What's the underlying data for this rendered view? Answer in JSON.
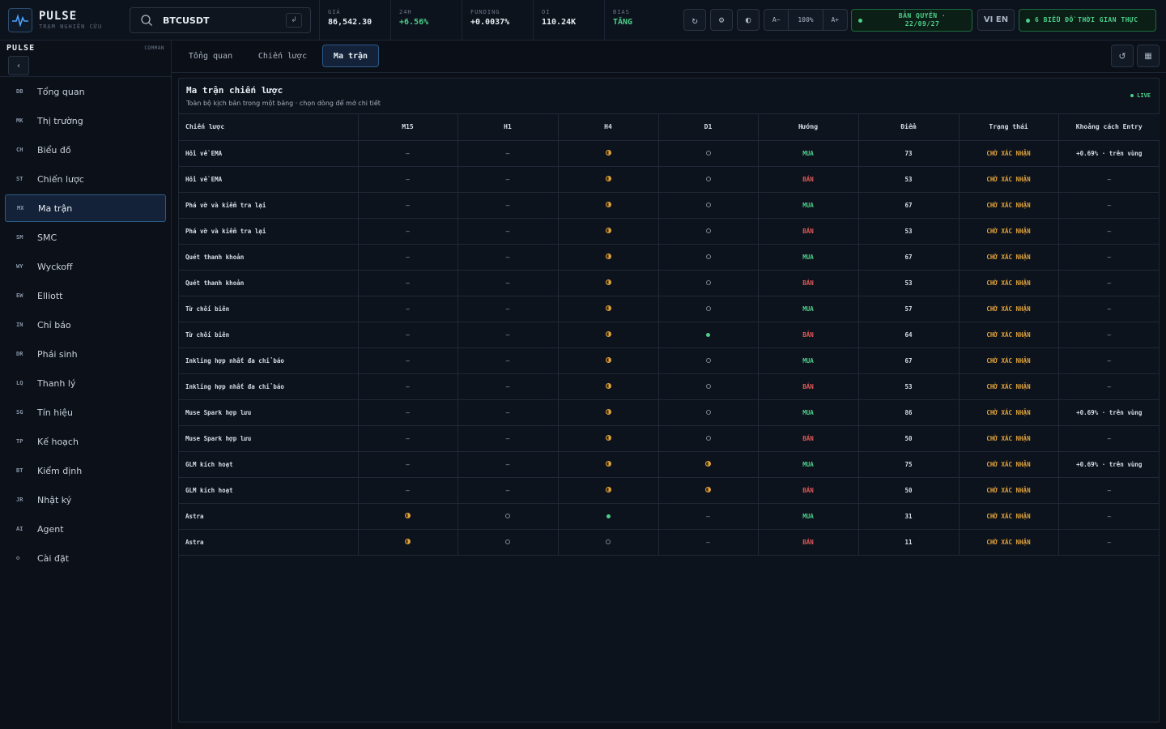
{
  "header": {
    "brand_title": "PULSE",
    "brand_sub": "TRẠM NGHIÊN CỨU",
    "search_value": "BTCUSDT",
    "enter_label": "↲",
    "stats": [
      {
        "label": "GIÁ",
        "value": "86,542.30"
      },
      {
        "label": "24H",
        "value": "+6.56%"
      },
      {
        "label": "FUNDING",
        "value": "+0.0037%"
      },
      {
        "label": "OI",
        "value": "110.24K"
      },
      {
        "label": "BIAS",
        "value": "TĂNG"
      }
    ],
    "refresh_icon": "↻",
    "settings_icon": "⚙",
    "contrast_icon": "◐",
    "zoom": {
      "minus": "A−",
      "level": "100%",
      "plus": "A+"
    },
    "license": "BẢN QUYỀN · 22/09/27",
    "lang": "VI EN",
    "realtime": "6 BIỂU ĐỒ THỜI GIAN THỰC"
  },
  "sidebar": {
    "title": "PULSE",
    "command": "COMMAN",
    "collapse_icon": "‹",
    "items": [
      {
        "code": "DB",
        "label": "Tổng quan"
      },
      {
        "code": "MK",
        "label": "Thị trường"
      },
      {
        "code": "CH",
        "label": "Biểu đồ"
      },
      {
        "code": "ST",
        "label": "Chiến lược"
      },
      {
        "code": "MX",
        "label": "Ma trận"
      },
      {
        "code": "SM",
        "label": "SMC"
      },
      {
        "code": "WY",
        "label": "Wyckoff"
      },
      {
        "code": "EW",
        "label": "Elliott"
      },
      {
        "code": "IN",
        "label": "Chỉ báo"
      },
      {
        "code": "DR",
        "label": "Phái sinh"
      },
      {
        "code": "LQ",
        "label": "Thanh lý"
      },
      {
        "code": "SG",
        "label": "Tín hiệu"
      },
      {
        "code": "TP",
        "label": "Kế hoạch"
      },
      {
        "code": "BT",
        "label": "Kiểm định"
      },
      {
        "code": "JR",
        "label": "Nhật ký"
      },
      {
        "code": "AI",
        "label": "Agent"
      },
      {
        "code": "⚙",
        "label": "Cài đặt"
      }
    ],
    "active_index": 4
  },
  "tabs": [
    {
      "label": "Tổng quan"
    },
    {
      "label": "Chiến lược"
    },
    {
      "label": "Ma trận"
    }
  ],
  "tools": {
    "reset_icon": "↺",
    "grid_icon": "▦"
  },
  "panel": {
    "title": "Ma trận chiến lược",
    "subtitle": "Toàn bộ kịch bản trong một bảng · chọn dòng để mở chi tiết",
    "live": "LIVE"
  },
  "table": {
    "columns": [
      "Chiến lược",
      "M15",
      "H1",
      "H4",
      "D1",
      "Hướng",
      "Điểm",
      "Trạng thái",
      "Khoảng cách Entry"
    ],
    "rows": [
      {
        "name": "Hồi về EMA",
        "m15": "dash",
        "h1": "dash",
        "h4": "half",
        "d1": "empty",
        "dir": "MUA",
        "score": "73",
        "status": "CHỜ XÁC NHẬN",
        "dist": "+0.69% · trên vùng"
      },
      {
        "name": "Hồi về EMA",
        "m15": "dash",
        "h1": "dash",
        "h4": "half",
        "d1": "empty",
        "dir": "BÁN",
        "score": "53",
        "status": "CHỜ XÁC NHẬN",
        "dist": "—"
      },
      {
        "name": "Phá vỡ và kiểm tra lại",
        "m15": "dash",
        "h1": "dash",
        "h4": "half",
        "d1": "empty",
        "dir": "MUA",
        "score": "67",
        "status": "CHỜ XÁC NHẬN",
        "dist": "—"
      },
      {
        "name": "Phá vỡ và kiểm tra lại",
        "m15": "dash",
        "h1": "dash",
        "h4": "half",
        "d1": "empty",
        "dir": "BÁN",
        "score": "53",
        "status": "CHỜ XÁC NHẬN",
        "dist": "—"
      },
      {
        "name": "Quét thanh khoản",
        "m15": "dash",
        "h1": "dash",
        "h4": "half",
        "d1": "empty",
        "dir": "MUA",
        "score": "67",
        "status": "CHỜ XÁC NHẬN",
        "dist": "—"
      },
      {
        "name": "Quét thanh khoản",
        "m15": "dash",
        "h1": "dash",
        "h4": "half",
        "d1": "empty",
        "dir": "BÁN",
        "score": "53",
        "status": "CHỜ XÁC NHẬN",
        "dist": "—"
      },
      {
        "name": "Từ chối biên",
        "m15": "dash",
        "h1": "dash",
        "h4": "half",
        "d1": "empty",
        "dir": "MUA",
        "score": "57",
        "status": "CHỜ XÁC NHẬN",
        "dist": "—"
      },
      {
        "name": "Từ chối biên",
        "m15": "dash",
        "h1": "dash",
        "h4": "half",
        "d1": "full",
        "dir": "BÁN",
        "score": "64",
        "status": "CHỜ XÁC NHẬN",
        "dist": "—"
      },
      {
        "name": "Inkling hợp nhất đa chỉ báo",
        "m15": "dash",
        "h1": "dash",
        "h4": "half",
        "d1": "empty",
        "dir": "MUA",
        "score": "67",
        "status": "CHỜ XÁC NHẬN",
        "dist": "—"
      },
      {
        "name": "Inkling hợp nhất đa chỉ báo",
        "m15": "dash",
        "h1": "dash",
        "h4": "half",
        "d1": "empty",
        "dir": "BÁN",
        "score": "53",
        "status": "CHỜ XÁC NHẬN",
        "dist": "—"
      },
      {
        "name": "Muse Spark hợp lưu",
        "m15": "dash",
        "h1": "dash",
        "h4": "half",
        "d1": "empty",
        "dir": "MUA",
        "score": "86",
        "status": "CHỜ XÁC NHẬN",
        "dist": "+0.69% · trên vùng"
      },
      {
        "name": "Muse Spark hợp lưu",
        "m15": "dash",
        "h1": "dash",
        "h4": "half",
        "d1": "empty",
        "dir": "BÁN",
        "score": "50",
        "status": "CHỜ XÁC NHẬN",
        "dist": "—"
      },
      {
        "name": "GLM kích hoạt",
        "m15": "dash",
        "h1": "dash",
        "h4": "half",
        "d1": "half",
        "dir": "MUA",
        "score": "75",
        "status": "CHỜ XÁC NHẬN",
        "dist": "+0.69% · trên vùng"
      },
      {
        "name": "GLM kích hoạt",
        "m15": "dash",
        "h1": "dash",
        "h4": "half",
        "d1": "half",
        "dir": "BÁN",
        "score": "50",
        "status": "CHỜ XÁC NHẬN",
        "dist": "—"
      },
      {
        "name": "Astra",
        "m15": "half",
        "h1": "empty",
        "h4": "full",
        "d1": "dash",
        "dir": "MUA",
        "score": "31",
        "status": "CHỜ XÁC NHẬN",
        "dist": "—"
      },
      {
        "name": "Astra",
        "m15": "half",
        "h1": "empty",
        "h4": "empty",
        "d1": "dash",
        "dir": "BÁN",
        "score": "11",
        "status": "CHỜ XÁC NHẬN",
        "dist": "—"
      }
    ]
  },
  "colors": {
    "accent": "#2d5a8a",
    "buy": "#4ccf8a",
    "sell": "#e05a5a",
    "pending": "#e0a23c"
  }
}
